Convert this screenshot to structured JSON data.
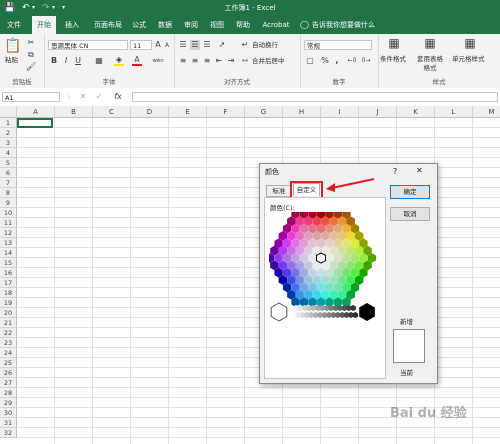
{
  "title_bar": {
    "title": "工作簿1 - Excel",
    "save_icon": "save-icon",
    "undo_icon": "undo-icon",
    "redo_icon": "redo-icon",
    "customize_icon": "quick-access-dropdown-icon"
  },
  "tabs": [
    "文件",
    "开始",
    "插入",
    "页面布局",
    "公式",
    "数据",
    "审阅",
    "视图",
    "帮助",
    "Acrobat"
  ],
  "active_tab": "开始",
  "tell_me": "告诉我你想要做什么",
  "ribbon": {
    "clipboard": {
      "paste": "粘贴",
      "label": "剪贴板"
    },
    "font": {
      "name": "思源黑体 CN",
      "size": "11",
      "bold": "B",
      "italic": "I",
      "underline": "U",
      "grow": "A",
      "shrink": "A",
      "fill_a": "A",
      "wen": "wén",
      "label": "字体"
    },
    "alignment": {
      "wrap": "自动换行",
      "merge": "合并后居中",
      "label": "对齐方式"
    },
    "number": {
      "format": "常规",
      "percent": "%",
      "comma": ",",
      "label": "数字"
    },
    "styles": {
      "conditional": "条件格式",
      "table": "套用表格格式",
      "cell": "单元格样式",
      "label": "样式"
    }
  },
  "formula_bar": {
    "name_box": "A1",
    "cancel": "✕",
    "enter": "✓",
    "fx": "fx",
    "value": ""
  },
  "columns": [
    "A",
    "B",
    "C",
    "D",
    "E",
    "F",
    "G",
    "H",
    "I",
    "J",
    "K",
    "L",
    "M"
  ],
  "rows": [
    "1",
    "2",
    "3",
    "4",
    "5",
    "6",
    "7",
    "8",
    "9",
    "10",
    "11",
    "12",
    "13",
    "14",
    "15",
    "16",
    "17",
    "18",
    "19",
    "20",
    "21",
    "22",
    "23",
    "24",
    "25",
    "26",
    "27",
    "28",
    "29",
    "30",
    "31",
    "32"
  ],
  "dialog": {
    "title": "颜色",
    "help": "?",
    "close": "✕",
    "tabs": [
      "标准",
      "自定义"
    ],
    "active_tab": "自定义",
    "colors_label": "颜色(C):",
    "ok": "确定",
    "cancel": "取消",
    "new_label": "新增",
    "current_label": "当前",
    "highlight_color": "#e02020"
  },
  "watermark": "Bai du 经验"
}
